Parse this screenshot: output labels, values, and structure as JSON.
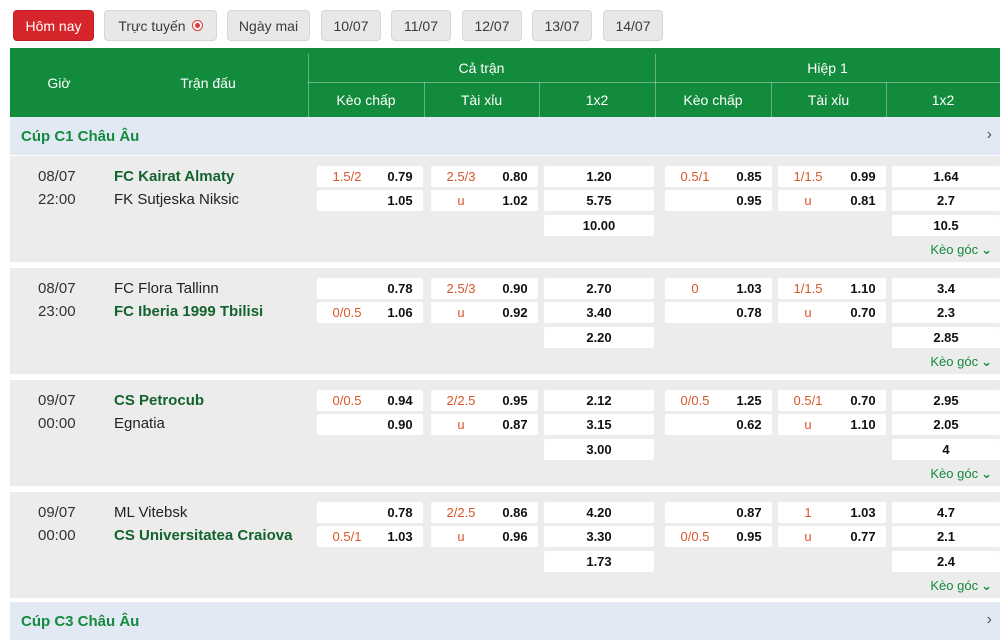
{
  "tabs": [
    {
      "label": "Hôm nay",
      "active": true
    },
    {
      "label": "Trực tuyến",
      "live": true
    },
    {
      "label": "Ngày mai"
    },
    {
      "label": "10/07"
    },
    {
      "label": "11/07"
    },
    {
      "label": "12/07"
    },
    {
      "label": "13/07"
    },
    {
      "label": "14/07"
    }
  ],
  "header": {
    "time": "Giờ",
    "match": "Trận đấu",
    "full_match": "Cả trận",
    "half1": "Hiệp 1",
    "handicap": "Kèo chấp",
    "over_under": "Tài xỉu",
    "one_x_two": "1x2"
  },
  "leagues": [
    {
      "name": "Cúp C1 Châu Âu"
    },
    {
      "name": "Cúp C3 Châu Âu"
    }
  ],
  "corner_label": "Kèo góc",
  "matches": [
    {
      "date": "08/07",
      "time": "22:00",
      "home": "FC Kairat Almaty",
      "away": "FK Sutjeska Niksic",
      "fav": "home",
      "ft_hdp": [
        [
          "1.5/2",
          "0.79"
        ],
        [
          "",
          "1.05"
        ]
      ],
      "ft_ou": [
        [
          "2.5/3",
          "0.80"
        ],
        [
          "u",
          "1.02"
        ]
      ],
      "ft_1x2": [
        "1.20",
        "5.75",
        "10.00"
      ],
      "h1_hdp": [
        [
          "0.5/1",
          "0.85"
        ],
        [
          "",
          "0.95"
        ]
      ],
      "h1_ou": [
        [
          "1/1.5",
          "0.99"
        ],
        [
          "u",
          "0.81"
        ]
      ],
      "h1_1x2": [
        "1.64",
        "2.7",
        "10.5"
      ]
    },
    {
      "date": "08/07",
      "time": "23:00",
      "home": "FC Flora Tallinn",
      "away": "FC Iberia 1999 Tbilisi",
      "fav": "away",
      "ft_hdp": [
        [
          "",
          "0.78"
        ],
        [
          "0/0.5",
          "1.06"
        ]
      ],
      "ft_ou": [
        [
          "2.5/3",
          "0.90"
        ],
        [
          "u",
          "0.92"
        ]
      ],
      "ft_1x2": [
        "2.70",
        "3.40",
        "2.20"
      ],
      "h1_hdp": [
        [
          "0",
          "1.03"
        ],
        [
          "",
          "0.78"
        ]
      ],
      "h1_ou": [
        [
          "1/1.5",
          "1.10"
        ],
        [
          "u",
          "0.70"
        ]
      ],
      "h1_1x2": [
        "3.4",
        "2.3",
        "2.85"
      ]
    },
    {
      "date": "09/07",
      "time": "00:00",
      "home": "CS Petrocub",
      "away": "Egnatia",
      "fav": "home",
      "ft_hdp": [
        [
          "0/0.5",
          "0.94"
        ],
        [
          "",
          "0.90"
        ]
      ],
      "ft_ou": [
        [
          "2/2.5",
          "0.95"
        ],
        [
          "u",
          "0.87"
        ]
      ],
      "ft_1x2": [
        "2.12",
        "3.15",
        "3.00"
      ],
      "h1_hdp": [
        [
          "0/0.5",
          "1.25"
        ],
        [
          "",
          "0.62"
        ]
      ],
      "h1_ou": [
        [
          "0.5/1",
          "0.70"
        ],
        [
          "u",
          "1.10"
        ]
      ],
      "h1_1x2": [
        "2.95",
        "2.05",
        "4"
      ]
    },
    {
      "date": "09/07",
      "time": "00:00",
      "home": "ML Vitebsk",
      "away": "CS Universitatea Craiova",
      "fav": "away",
      "ft_hdp": [
        [
          "",
          "0.78"
        ],
        [
          "0.5/1",
          "1.03"
        ]
      ],
      "ft_ou": [
        [
          "2/2.5",
          "0.86"
        ],
        [
          "u",
          "0.96"
        ]
      ],
      "ft_1x2": [
        "4.20",
        "3.30",
        "1.73"
      ],
      "h1_hdp": [
        [
          "",
          "0.87"
        ],
        [
          "0/0.5",
          "0.95"
        ]
      ],
      "h1_ou": [
        [
          "1",
          "1.03"
        ],
        [
          "u",
          "0.77"
        ]
      ],
      "h1_1x2": [
        "4.7",
        "2.1",
        "2.4"
      ]
    }
  ]
}
